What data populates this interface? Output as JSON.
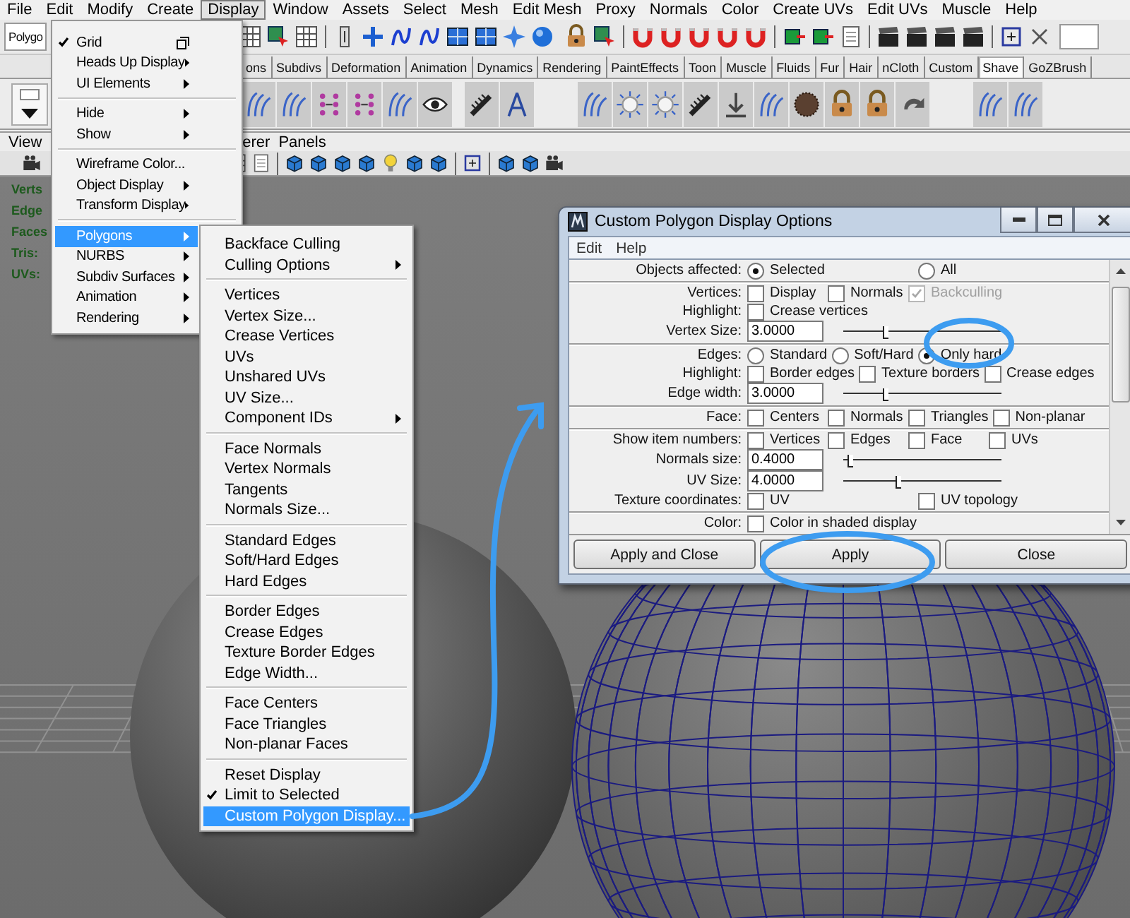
{
  "menu_bar": [
    {
      "label": "File",
      "selected": false
    },
    {
      "label": "Edit",
      "selected": false
    },
    {
      "label": "Modify",
      "selected": false
    },
    {
      "label": "Create",
      "selected": false
    },
    {
      "label": "Display",
      "selected": true
    },
    {
      "label": "Window",
      "selected": false
    },
    {
      "label": "Assets",
      "selected": false
    },
    {
      "label": "Select",
      "selected": false
    },
    {
      "label": "Mesh",
      "selected": false
    },
    {
      "label": "Edit Mesh",
      "selected": false
    },
    {
      "label": "Proxy",
      "selected": false
    },
    {
      "label": "Normals",
      "selected": false
    },
    {
      "label": "Color",
      "selected": false
    },
    {
      "label": "Create UVs",
      "selected": false
    },
    {
      "label": "Edit UVs",
      "selected": false
    },
    {
      "label": "Muscle",
      "selected": false
    },
    {
      "label": "Help",
      "selected": false
    }
  ],
  "toolbar": {
    "mode_field": "Polygo"
  },
  "shelf_tabs": [
    {
      "label": "ons",
      "selected": false
    },
    {
      "label": "Subdivs",
      "selected": false
    },
    {
      "label": "Deformation",
      "selected": false
    },
    {
      "label": "Animation",
      "selected": false
    },
    {
      "label": "Dynamics",
      "selected": false
    },
    {
      "label": "Rendering",
      "selected": false
    },
    {
      "label": "PaintEffects",
      "selected": false
    },
    {
      "label": "Toon",
      "selected": false
    },
    {
      "label": "Muscle",
      "selected": false
    },
    {
      "label": "Fluids",
      "selected": false
    },
    {
      "label": "Fur",
      "selected": false
    },
    {
      "label": "Hair",
      "selected": false
    },
    {
      "label": "nCloth",
      "selected": false
    },
    {
      "label": "Custom",
      "selected": false
    },
    {
      "label": "Shave",
      "selected": true
    },
    {
      "label": "GoZBrush",
      "selected": false
    }
  ],
  "panel_menu": [
    "View",
    "erer",
    "Panels"
  ],
  "hud": [
    "Verts",
    "Edge",
    "Faces",
    "Tris:",
    "UVs:"
  ],
  "display_menu": {
    "sections": [
      [
        {
          "label": "Grid",
          "checked": true,
          "selected": false,
          "submenu": false,
          "option_box": true
        },
        {
          "label": "Heads Up Display",
          "checked": false,
          "selected": false,
          "submenu": true,
          "option_box": false
        },
        {
          "label": "UI Elements",
          "checked": false,
          "selected": false,
          "submenu": true,
          "option_box": false
        }
      ],
      [
        {
          "label": "Hide",
          "checked": false,
          "selected": false,
          "submenu": true,
          "option_box": false
        },
        {
          "label": "Show",
          "checked": false,
          "selected": false,
          "submenu": true,
          "option_box": false
        }
      ],
      [
        {
          "label": "Wireframe Color...",
          "checked": false,
          "selected": false,
          "submenu": false,
          "option_box": false
        },
        {
          "label": "Object Display",
          "checked": false,
          "selected": false,
          "submenu": true,
          "option_box": false
        },
        {
          "label": "Transform Display",
          "checked": false,
          "selected": false,
          "submenu": true,
          "option_box": false
        }
      ],
      [
        {
          "label": "Polygons",
          "checked": false,
          "selected": true,
          "submenu": true,
          "option_box": false
        },
        {
          "label": "NURBS",
          "checked": false,
          "selected": false,
          "submenu": true,
          "option_box": false
        },
        {
          "label": "Subdiv Surfaces",
          "checked": false,
          "selected": false,
          "submenu": true,
          "option_box": false
        },
        {
          "label": "Animation",
          "checked": false,
          "selected": false,
          "submenu": true,
          "option_box": false
        },
        {
          "label": "Rendering",
          "checked": false,
          "selected": false,
          "submenu": true,
          "option_box": false
        }
      ]
    ]
  },
  "polygons_menu": {
    "sections": [
      [
        {
          "label": "Backface Culling",
          "checked": false,
          "selected": false,
          "submenu": false
        },
        {
          "label": "Culling Options",
          "checked": false,
          "selected": false,
          "submenu": true
        }
      ],
      [
        {
          "label": "Vertices",
          "checked": false,
          "selected": false,
          "submenu": false
        },
        {
          "label": "Vertex Size...",
          "checked": false,
          "selected": false,
          "submenu": false
        },
        {
          "label": "Crease Vertices",
          "checked": false,
          "selected": false,
          "submenu": false
        },
        {
          "label": "UVs",
          "checked": false,
          "selected": false,
          "submenu": false
        },
        {
          "label": "Unshared UVs",
          "checked": false,
          "selected": false,
          "submenu": false
        },
        {
          "label": "UV Size...",
          "checked": false,
          "selected": false,
          "submenu": false
        },
        {
          "label": "Component IDs",
          "checked": false,
          "selected": false,
          "submenu": true
        }
      ],
      [
        {
          "label": "Face Normals",
          "checked": false,
          "selected": false,
          "submenu": false
        },
        {
          "label": "Vertex Normals",
          "checked": false,
          "selected": false,
          "submenu": false
        },
        {
          "label": "Tangents",
          "checked": false,
          "selected": false,
          "submenu": false
        },
        {
          "label": "Normals Size...",
          "checked": false,
          "selected": false,
          "submenu": false
        }
      ],
      [
        {
          "label": "Standard Edges",
          "checked": false,
          "selected": false,
          "submenu": false
        },
        {
          "label": "Soft/Hard Edges",
          "checked": false,
          "selected": false,
          "submenu": false
        },
        {
          "label": "Hard Edges",
          "checked": false,
          "selected": false,
          "submenu": false
        }
      ],
      [
        {
          "label": "Border Edges",
          "checked": false,
          "selected": false,
          "submenu": false
        },
        {
          "label": "Crease Edges",
          "checked": false,
          "selected": false,
          "submenu": false
        },
        {
          "label": "Texture Border Edges",
          "checked": false,
          "selected": false,
          "submenu": false
        },
        {
          "label": "Edge Width...",
          "checked": false,
          "selected": false,
          "submenu": false
        }
      ],
      [
        {
          "label": "Face Centers",
          "checked": false,
          "selected": false,
          "submenu": false
        },
        {
          "label": "Face Triangles",
          "checked": false,
          "selected": false,
          "submenu": false
        },
        {
          "label": "Non-planar Faces",
          "checked": false,
          "selected": false,
          "submenu": false
        }
      ],
      [
        {
          "label": "Reset Display",
          "checked": false,
          "selected": false,
          "submenu": false
        },
        {
          "label": "Limit to Selected",
          "checked": true,
          "selected": false,
          "submenu": false
        },
        {
          "label": "Custom Polygon Display...",
          "checked": false,
          "selected": true,
          "submenu": false
        }
      ]
    ]
  },
  "dialog": {
    "title": "Custom Polygon Display Options",
    "menu": [
      "Edit",
      "Help"
    ],
    "sections": [
      [
        {
          "kind": "radio",
          "label": "Objects affected:",
          "options": [
            {
              "label": "Selected",
              "selected": true
            },
            {
              "label": "All",
              "selected": false
            }
          ]
        }
      ],
      [
        {
          "kind": "checks",
          "label": "Vertices:",
          "options": [
            {
              "label": "Display",
              "checked": false,
              "disabled": false
            },
            {
              "label": "Normals",
              "checked": false,
              "disabled": false
            },
            {
              "label": "Backculling",
              "checked": true,
              "disabled": true
            }
          ]
        },
        {
          "kind": "checks",
          "label": "Highlight:",
          "options": [
            {
              "label": "Crease vertices",
              "checked": false,
              "disabled": false
            }
          ]
        },
        {
          "kind": "number",
          "label": "Vertex Size:",
          "value": "3.0000",
          "level": 0.25
        }
      ],
      [
        {
          "kind": "radio",
          "label": "Edges:",
          "options": [
            {
              "label": "Standard",
              "selected": false
            },
            {
              "label": "Soft/Hard",
              "selected": false
            },
            {
              "label": "Only hard",
              "selected": true
            }
          ]
        },
        {
          "kind": "checks",
          "label": "Highlight:",
          "options": [
            {
              "label": "Border edges",
              "checked": false,
              "disabled": false
            },
            {
              "label": "Texture borders",
              "checked": false,
              "disabled": false
            },
            {
              "label": "Crease edges",
              "checked": false,
              "disabled": false
            }
          ]
        },
        {
          "kind": "number",
          "label": "Edge width:",
          "value": "3.0000",
          "level": 0.25
        }
      ],
      [
        {
          "kind": "checks",
          "label": "Face:",
          "options": [
            {
              "label": "Centers",
              "checked": false,
              "disabled": false
            },
            {
              "label": "Normals",
              "checked": false,
              "disabled": false
            },
            {
              "label": "Triangles",
              "checked": false,
              "disabled": false
            },
            {
              "label": "Non-planar",
              "checked": false,
              "disabled": false
            }
          ]
        }
      ],
      [
        {
          "kind": "checks",
          "label": "Show item numbers:",
          "options": [
            {
              "label": "Vertices",
              "checked": false,
              "disabled": false
            },
            {
              "label": "Edges",
              "checked": false,
              "disabled": false
            },
            {
              "label": "Face",
              "checked": false,
              "disabled": false
            },
            {
              "label": "UVs",
              "checked": false,
              "disabled": false
            }
          ]
        },
        {
          "kind": "number",
          "label": "Normals size:",
          "value": "0.4000",
          "level": 0.03
        },
        {
          "kind": "number",
          "label": "UV Size:",
          "value": "4.0000",
          "level": 0.33
        },
        {
          "kind": "checks",
          "label": "Texture coordinates:",
          "options": [
            {
              "label": "UV",
              "checked": false,
              "disabled": false
            },
            {
              "label": "UV topology",
              "checked": false,
              "disabled": false
            }
          ]
        }
      ],
      [
        {
          "kind": "checks",
          "label": "Color:",
          "options": [
            {
              "label": "Color in shaded display",
              "checked": false,
              "disabled": false
            }
          ]
        }
      ]
    ],
    "buttons": [
      "Apply and Close",
      "Apply",
      "Close"
    ]
  }
}
